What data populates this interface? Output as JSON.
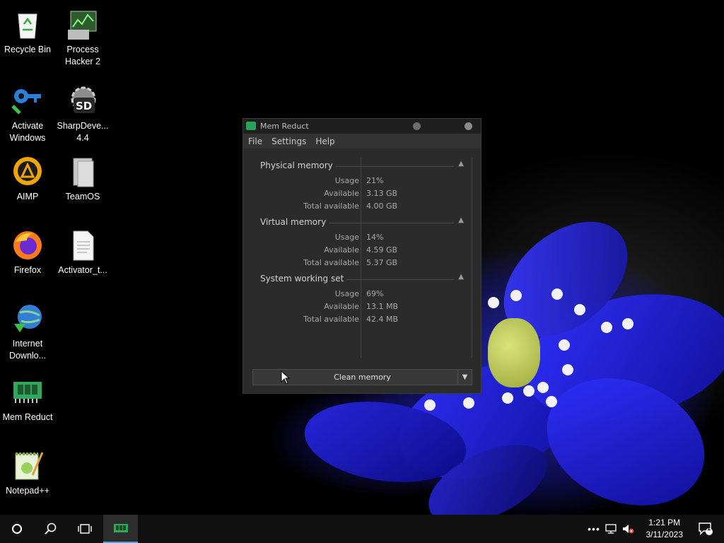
{
  "desktop": {
    "icons": [
      {
        "label": "Recycle Bin"
      },
      {
        "label": "Process Hacker 2"
      },
      {
        "label": "Activate Windows"
      },
      {
        "label": "SharpDeve... 4.4"
      },
      {
        "label": "AIMP"
      },
      {
        "label": "TeamOS"
      },
      {
        "label": "Firefox"
      },
      {
        "label": "Activator_t..."
      },
      {
        "label": "Internet Downlo..."
      },
      {
        "label": "Mem Reduct"
      },
      {
        "label": "Notepad++"
      }
    ]
  },
  "window": {
    "title": "Mem Reduct",
    "menu": [
      "File",
      "Settings",
      "Help"
    ],
    "groups": [
      {
        "title": "Physical memory",
        "rows": [
          {
            "key": "Usage",
            "value": "21%"
          },
          {
            "key": "Available",
            "value": "3.13 GB"
          },
          {
            "key": "Total available",
            "value": "4.00 GB"
          }
        ]
      },
      {
        "title": "Virtual memory",
        "rows": [
          {
            "key": "Usage",
            "value": "14%"
          },
          {
            "key": "Available",
            "value": "4.59 GB"
          },
          {
            "key": "Total available",
            "value": "5.37 GB"
          }
        ]
      },
      {
        "title": "System working set",
        "rows": [
          {
            "key": "Usage",
            "value": "69%"
          },
          {
            "key": "Available",
            "value": "13.1 MB"
          },
          {
            "key": "Total available",
            "value": "42.4 MB"
          }
        ]
      }
    ],
    "clean_button": "Clean memory"
  },
  "taskbar": {
    "time": "1:21 PM",
    "date": "3/11/2023",
    "notification_count": "1"
  },
  "colors": {
    "window_bg": "#2b2b2b",
    "taskbar_bg": "#101010",
    "flower_blue": "#2a2ae0",
    "mem_reduct_green": "#29a35a"
  }
}
